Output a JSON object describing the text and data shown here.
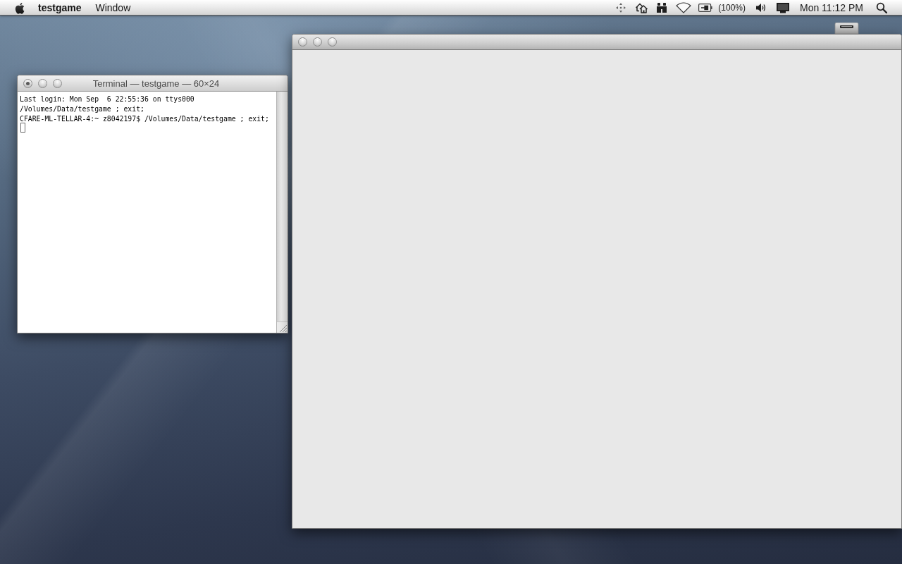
{
  "menu_bar": {
    "app_name": "testgame",
    "menus": [
      {
        "label": "Window"
      }
    ],
    "battery": "(100%)",
    "clock": "Mon 11:12 PM"
  },
  "windows": [
    {
      "kind": "terminal",
      "title": "Terminal — testgame — 60×24",
      "busy": true,
      "lines": [
        "Last login: Mon Sep  6 22:55:36 on ttys000",
        "/Volumes/Data/testgame ; exit;",
        "CFARE-ML-TELLAR-4:~ z8042197$ /Volumes/Data/testgame ; exit;"
      ]
    },
    {
      "kind": "blank",
      "busy": false
    }
  ]
}
